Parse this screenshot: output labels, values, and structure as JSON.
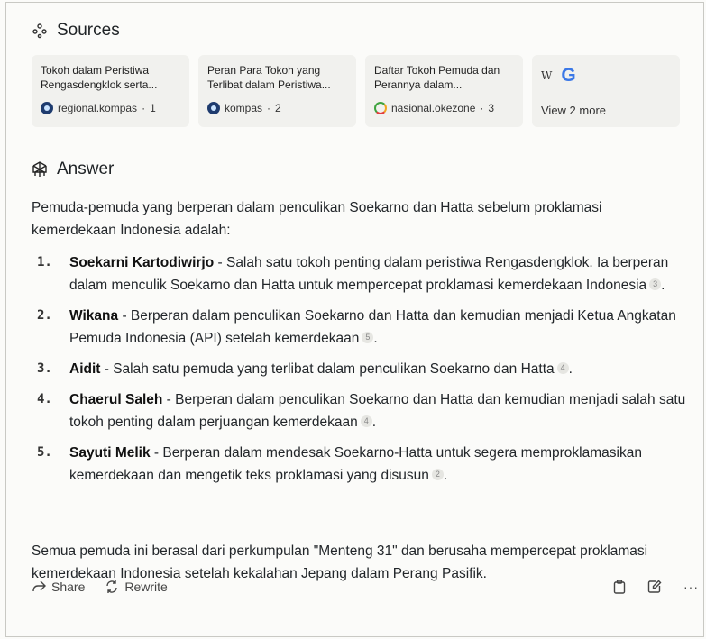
{
  "sources": {
    "heading": "Sources",
    "icon": "sources-dots-icon",
    "cards": [
      {
        "title": "Tokoh dalam Peristiwa Rengasdengklok serta...",
        "site": "regional.kompas",
        "index": "1",
        "favicon": "kompas-favicon"
      },
      {
        "title": "Peran Para Tokoh yang Terlibat dalam Peristiwa...",
        "site": "kompas",
        "index": "2",
        "favicon": "kompas-favicon"
      },
      {
        "title": "Daftar Tokoh Pemuda dan Perannya dalam...",
        "site": "nasional.okezone",
        "index": "3",
        "favicon": "okezone-favicon"
      }
    ],
    "more": {
      "wiki_glyph": "W",
      "google_glyph": "G",
      "label": "View 2 more"
    }
  },
  "answer": {
    "heading": "Answer",
    "icon": "perplexity-logo-icon",
    "intro": "Pemuda-pemuda yang berperan dalam penculikan Soekarno dan Hatta sebelum proklamasi kemerdekaan Indonesia adalah:",
    "items": [
      {
        "num": "1.",
        "name": "Soekarni Kartodiwirjo",
        "text": " - Salah satu tokoh penting dalam peristiwa Rengasdengklok. Ia berperan dalam menculik Soekarno dan Hatta untuk mempercepat proklamasi kemerdekaan Indonesia",
        "cite": "3",
        "end": "."
      },
      {
        "num": "2.",
        "name": "Wikana",
        "text": " - Berperan dalam penculikan Soekarno dan Hatta dan kemudian menjadi Ketua Angkatan Pemuda Indonesia (API) setelah kemerdekaan",
        "cite": "5",
        "end": "."
      },
      {
        "num": "3.",
        "name": "Aidit",
        "text": " - Salah satu pemuda yang terlibat dalam penculikan Soekarno dan Hatta",
        "cite": "4",
        "end": "."
      },
      {
        "num": "4.",
        "name": "Chaerul Saleh",
        "text": " - Berperan dalam penculikan Soekarno dan Hatta dan kemudian menjadi salah satu tokoh penting dalam perjuangan kemerdekaan",
        "cite": "4",
        "end": "."
      },
      {
        "num": "5.",
        "name": "Sayuti Melik",
        "text": " - Berperan dalam mendesak Soekarno-Hatta untuk segera memproklamasikan kemerdekaan dan mengetik teks proklamasi yang disusun",
        "cite": "2",
        "end": "."
      }
    ],
    "outro": "Semua pemuda ini berasal dari perkumpulan \"Menteng 31\" dan berusaha mempercepat proklamasi kemerdekaan Indonesia setelah kekalahan Jepang dalam Perang Pasifik."
  },
  "actions": {
    "share_label": "Share",
    "rewrite_label": "Rewrite",
    "copy_icon": "clipboard-icon",
    "edit_icon": "edit-icon",
    "more_icon": "ellipsis-icon",
    "more_glyph": "···"
  }
}
